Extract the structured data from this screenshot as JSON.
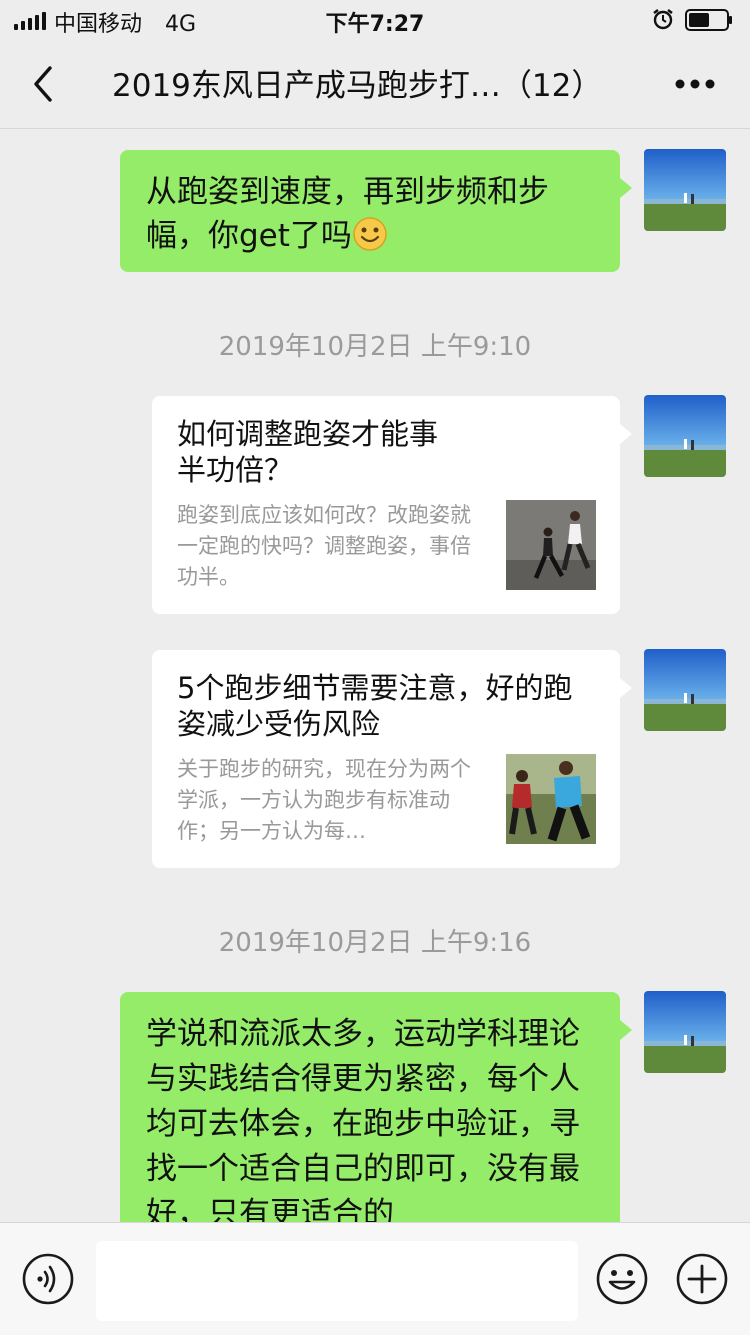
{
  "status_bar": {
    "carrier": "中国移动",
    "network": "4G",
    "time": "下午7:27",
    "icons": [
      "signal-icon",
      "alarm-icon",
      "battery-icon"
    ]
  },
  "nav": {
    "title": "2019东风日产成马跑步打…（12）",
    "back_icon": "chevron-left-icon",
    "more_icon": "more-icon"
  },
  "messages": [
    {
      "type": "text",
      "text": "从跑姿到速度，再到步频和步幅，你get了吗",
      "emoji": "smiley-emoji"
    },
    {
      "type": "timestamp",
      "text": "2019年10月2日 上午9:10"
    },
    {
      "type": "link_card",
      "title": "如何调整跑姿才能事半功倍？",
      "description": "跑姿到底应该如何改？改跑姿就一定跑的快吗？调整跑姿，事倍功半。",
      "thumbnail": "runners-photo"
    },
    {
      "type": "link_card",
      "title": "5个跑步细节需要注意，好的跑姿减少受伤风险",
      "description": "关于跑步的研究，现在分为两个学派，一方认为跑步有标准动作；另一方认为每…",
      "thumbnail": "runners-photo"
    },
    {
      "type": "timestamp",
      "text": "2019年10月2日 上午9:16"
    },
    {
      "type": "text",
      "text": "学说和流派太多，运动学科理论与实践结合得更为紧密，每个人均可去体会，在跑步中验证，寻找一个适合自己的即可，没有最好，只有更适合的"
    }
  ],
  "input_bar": {
    "voice_icon": "voice-icon",
    "emoji_icon": "emoji-icon",
    "plus_icon": "plus-icon",
    "placeholder": ""
  },
  "colors": {
    "background": "#ededed",
    "bubble_green": "#95ec69",
    "timestamp": "#9a9a9a"
  }
}
